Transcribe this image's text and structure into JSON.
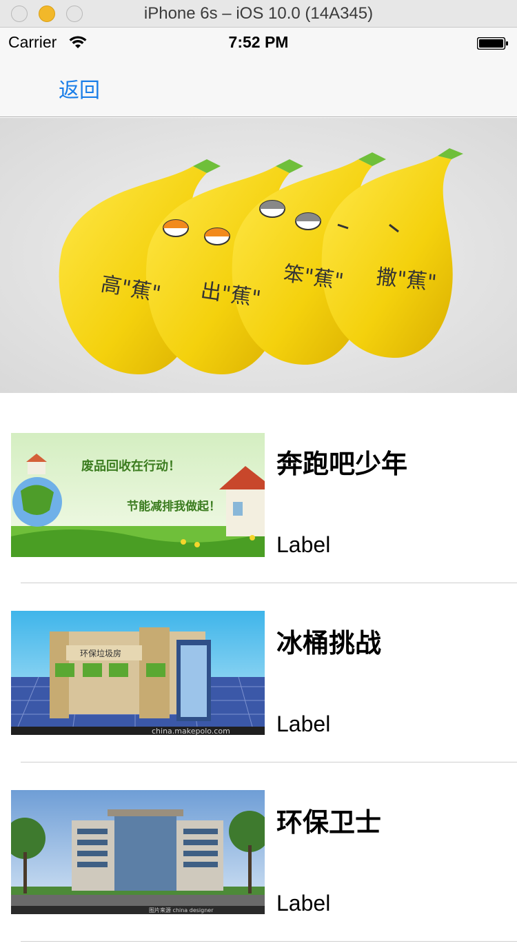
{
  "simulator": {
    "title": "iPhone 6s – iOS 10.0 (14A345)"
  },
  "status_bar": {
    "carrier": "Carrier",
    "time": "7:52 PM",
    "icons": [
      "wifi-icon",
      "battery-icon"
    ]
  },
  "nav": {
    "back_label": "返回"
  },
  "banner": {
    "image": "banana-characters-image"
  },
  "list": {
    "items": [
      {
        "title": "奔跑吧少年",
        "label": "Label",
        "thumb": "recycling-poster-image",
        "thumb_text_1": "废品回收在行动！",
        "thumb_text_2": "节能减排我做起！"
      },
      {
        "title": "冰桶挑战",
        "label": "Label",
        "thumb": "recycling-kiosk-image",
        "thumb_text_1": "环保垃圾房",
        "thumb_text_2": "china.makepolo.com"
      },
      {
        "title": "环保卫士",
        "label": "Label",
        "thumb": "office-building-image",
        "thumb_text_1": "图片来源 china designer",
        "thumb_text_2": ""
      }
    ]
  },
  "colors": {
    "tint": "#1a7ee8",
    "nav_background": "#f7f7f7",
    "separator": "#cfcfcf"
  }
}
